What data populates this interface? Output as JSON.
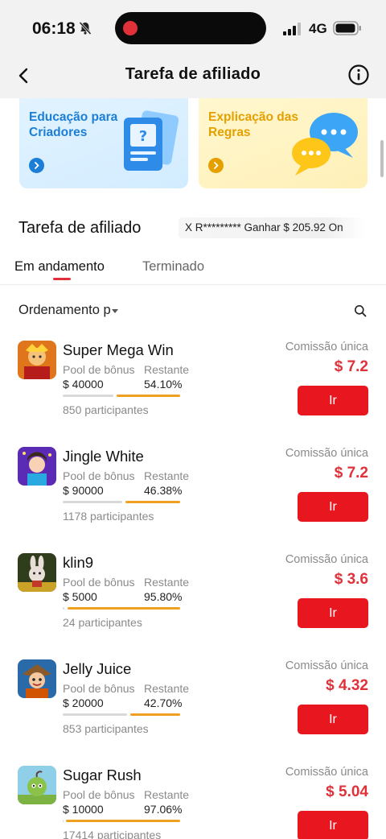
{
  "status_bar": {
    "time": "06:18",
    "network": "4G"
  },
  "header": {
    "title": "Tarefa de afiliado"
  },
  "banners": [
    {
      "title": "Educação para Criadores"
    },
    {
      "title": "Explicação das Regras"
    }
  ],
  "section": {
    "title": "Tarefa de afiliado",
    "ticker": "X R********* Ganhar $ 205.92 On"
  },
  "tabs": [
    {
      "label": "Em andamento",
      "active": true
    },
    {
      "label": "Terminado",
      "active": false
    }
  ],
  "sort": {
    "label": "Ordenamento p"
  },
  "colors": {
    "accent": "#e0313a",
    "button": "#e8161f",
    "progress": "#f0a020"
  },
  "labels": {
    "pool": "Pool de bônus",
    "remaining": "Restante",
    "commission": "Comissão única",
    "go": "Ir"
  },
  "tasks": [
    {
      "name": "Super Mega Win",
      "pool": "$ 40000",
      "remaining": "54.10%",
      "remaining_pct": 54.1,
      "participants": "850 participantes",
      "commission": "$ 7.2"
    },
    {
      "name": "Jingle White",
      "pool": "$ 90000",
      "remaining": "46.38%",
      "remaining_pct": 46.38,
      "participants": "1178 participantes",
      "commission": "$ 7.2"
    },
    {
      "name": "klin9",
      "pool": "$ 5000",
      "remaining": "95.80%",
      "remaining_pct": 95.8,
      "participants": "24 participantes",
      "commission": "$ 3.6"
    },
    {
      "name": "Jelly Juice",
      "pool": "$ 20000",
      "remaining": "42.70%",
      "remaining_pct": 42.7,
      "participants": "853 participantes",
      "commission": "$ 4.32"
    },
    {
      "name": "Sugar Rush",
      "pool": "$ 10000",
      "remaining": "97.06%",
      "remaining_pct": 97.06,
      "participants": "17414 participantes",
      "commission": "$ 5.04"
    }
  ]
}
